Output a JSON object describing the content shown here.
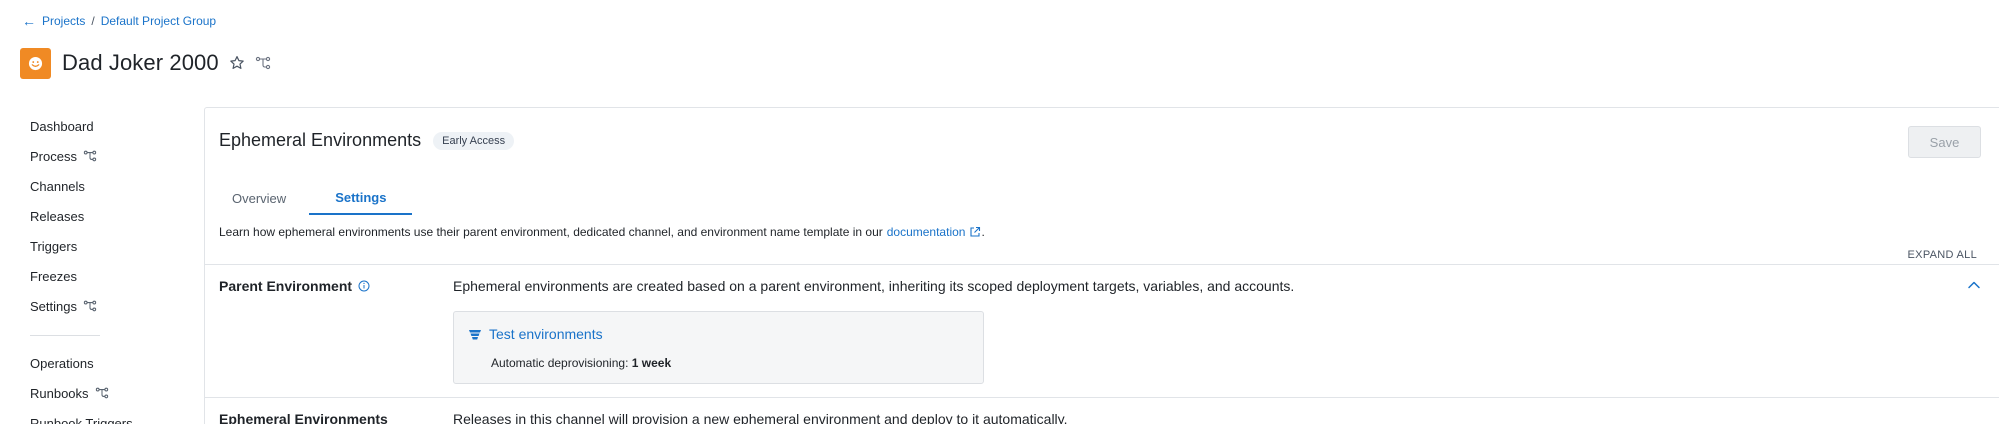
{
  "breadcrumb": {
    "back_arrow": "←",
    "projects": "Projects",
    "separator": "/",
    "group": "Default Project Group"
  },
  "project": {
    "title": "Dad Joker 2000",
    "avatar_icon": "smile-icon",
    "avatar_color": "#f08a24"
  },
  "sidebar": {
    "items": [
      {
        "label": "Dashboard",
        "branch": false
      },
      {
        "label": "Process",
        "branch": true
      },
      {
        "label": "Channels",
        "branch": false
      },
      {
        "label": "Releases",
        "branch": false
      },
      {
        "label": "Triggers",
        "branch": false
      },
      {
        "label": "Freezes",
        "branch": false
      },
      {
        "label": "Settings",
        "branch": true
      }
    ],
    "ops_items": [
      {
        "label": "Operations",
        "branch": false
      },
      {
        "label": "Runbooks",
        "branch": true
      },
      {
        "label": "Runbook Triggers",
        "branch": false
      }
    ]
  },
  "panel": {
    "title": "Ephemeral Environments",
    "badge": "Early Access",
    "save_label": "Save",
    "tabs": [
      {
        "label": "Overview"
      },
      {
        "label": "Settings"
      }
    ],
    "active_tab": "Settings",
    "learn_text": "Learn how ephemeral environments use their parent environment, dedicated channel, and environment name template in our",
    "learn_link": "documentation",
    "learn_period": ".",
    "expand_all": "EXPAND ALL",
    "parent_env": {
      "label": "Parent Environment",
      "description": "Ephemeral environments are created based on a parent environment, inheriting its scoped deployment targets, variables, and accounts.",
      "card_name": "Test environments",
      "card_sub_label": "Automatic deprovisioning:",
      "card_sub_value": "1 week"
    },
    "eph_env": {
      "label": "Ephemeral Environments",
      "description": "Releases in this channel will provision a new ephemeral environment and deploy to it automatically."
    }
  },
  "colors": {
    "accent": "#1a73c9",
    "brand_orange": "#f08a24"
  }
}
